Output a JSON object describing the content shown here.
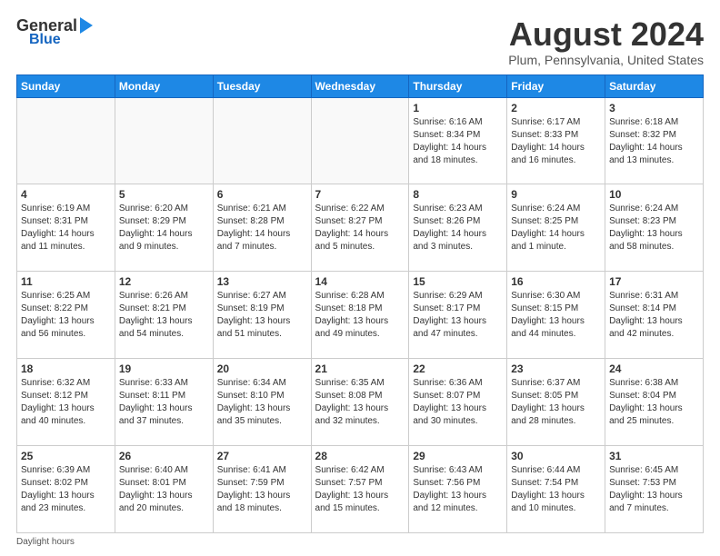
{
  "header": {
    "logo_general": "General",
    "logo_blue": "Blue",
    "month_title": "August 2024",
    "location": "Plum, Pennsylvania, United States"
  },
  "days_of_week": [
    "Sunday",
    "Monday",
    "Tuesday",
    "Wednesday",
    "Thursday",
    "Friday",
    "Saturday"
  ],
  "footer": {
    "note": "Daylight hours"
  },
  "weeks": [
    [
      {
        "num": "",
        "info": ""
      },
      {
        "num": "",
        "info": ""
      },
      {
        "num": "",
        "info": ""
      },
      {
        "num": "",
        "info": ""
      },
      {
        "num": "1",
        "info": "Sunrise: 6:16 AM\nSunset: 8:34 PM\nDaylight: 14 hours\nand 18 minutes."
      },
      {
        "num": "2",
        "info": "Sunrise: 6:17 AM\nSunset: 8:33 PM\nDaylight: 14 hours\nand 16 minutes."
      },
      {
        "num": "3",
        "info": "Sunrise: 6:18 AM\nSunset: 8:32 PM\nDaylight: 14 hours\nand 13 minutes."
      }
    ],
    [
      {
        "num": "4",
        "info": "Sunrise: 6:19 AM\nSunset: 8:31 PM\nDaylight: 14 hours\nand 11 minutes."
      },
      {
        "num": "5",
        "info": "Sunrise: 6:20 AM\nSunset: 8:29 PM\nDaylight: 14 hours\nand 9 minutes."
      },
      {
        "num": "6",
        "info": "Sunrise: 6:21 AM\nSunset: 8:28 PM\nDaylight: 14 hours\nand 7 minutes."
      },
      {
        "num": "7",
        "info": "Sunrise: 6:22 AM\nSunset: 8:27 PM\nDaylight: 14 hours\nand 5 minutes."
      },
      {
        "num": "8",
        "info": "Sunrise: 6:23 AM\nSunset: 8:26 PM\nDaylight: 14 hours\nand 3 minutes."
      },
      {
        "num": "9",
        "info": "Sunrise: 6:24 AM\nSunset: 8:25 PM\nDaylight: 14 hours\nand 1 minute."
      },
      {
        "num": "10",
        "info": "Sunrise: 6:24 AM\nSunset: 8:23 PM\nDaylight: 13 hours\nand 58 minutes."
      }
    ],
    [
      {
        "num": "11",
        "info": "Sunrise: 6:25 AM\nSunset: 8:22 PM\nDaylight: 13 hours\nand 56 minutes."
      },
      {
        "num": "12",
        "info": "Sunrise: 6:26 AM\nSunset: 8:21 PM\nDaylight: 13 hours\nand 54 minutes."
      },
      {
        "num": "13",
        "info": "Sunrise: 6:27 AM\nSunset: 8:19 PM\nDaylight: 13 hours\nand 51 minutes."
      },
      {
        "num": "14",
        "info": "Sunrise: 6:28 AM\nSunset: 8:18 PM\nDaylight: 13 hours\nand 49 minutes."
      },
      {
        "num": "15",
        "info": "Sunrise: 6:29 AM\nSunset: 8:17 PM\nDaylight: 13 hours\nand 47 minutes."
      },
      {
        "num": "16",
        "info": "Sunrise: 6:30 AM\nSunset: 8:15 PM\nDaylight: 13 hours\nand 44 minutes."
      },
      {
        "num": "17",
        "info": "Sunrise: 6:31 AM\nSunset: 8:14 PM\nDaylight: 13 hours\nand 42 minutes."
      }
    ],
    [
      {
        "num": "18",
        "info": "Sunrise: 6:32 AM\nSunset: 8:12 PM\nDaylight: 13 hours\nand 40 minutes."
      },
      {
        "num": "19",
        "info": "Sunrise: 6:33 AM\nSunset: 8:11 PM\nDaylight: 13 hours\nand 37 minutes."
      },
      {
        "num": "20",
        "info": "Sunrise: 6:34 AM\nSunset: 8:10 PM\nDaylight: 13 hours\nand 35 minutes."
      },
      {
        "num": "21",
        "info": "Sunrise: 6:35 AM\nSunset: 8:08 PM\nDaylight: 13 hours\nand 32 minutes."
      },
      {
        "num": "22",
        "info": "Sunrise: 6:36 AM\nSunset: 8:07 PM\nDaylight: 13 hours\nand 30 minutes."
      },
      {
        "num": "23",
        "info": "Sunrise: 6:37 AM\nSunset: 8:05 PM\nDaylight: 13 hours\nand 28 minutes."
      },
      {
        "num": "24",
        "info": "Sunrise: 6:38 AM\nSunset: 8:04 PM\nDaylight: 13 hours\nand 25 minutes."
      }
    ],
    [
      {
        "num": "25",
        "info": "Sunrise: 6:39 AM\nSunset: 8:02 PM\nDaylight: 13 hours\nand 23 minutes."
      },
      {
        "num": "26",
        "info": "Sunrise: 6:40 AM\nSunset: 8:01 PM\nDaylight: 13 hours\nand 20 minutes."
      },
      {
        "num": "27",
        "info": "Sunrise: 6:41 AM\nSunset: 7:59 PM\nDaylight: 13 hours\nand 18 minutes."
      },
      {
        "num": "28",
        "info": "Sunrise: 6:42 AM\nSunset: 7:57 PM\nDaylight: 13 hours\nand 15 minutes."
      },
      {
        "num": "29",
        "info": "Sunrise: 6:43 AM\nSunset: 7:56 PM\nDaylight: 13 hours\nand 12 minutes."
      },
      {
        "num": "30",
        "info": "Sunrise: 6:44 AM\nSunset: 7:54 PM\nDaylight: 13 hours\nand 10 minutes."
      },
      {
        "num": "31",
        "info": "Sunrise: 6:45 AM\nSunset: 7:53 PM\nDaylight: 13 hours\nand 7 minutes."
      }
    ]
  ]
}
